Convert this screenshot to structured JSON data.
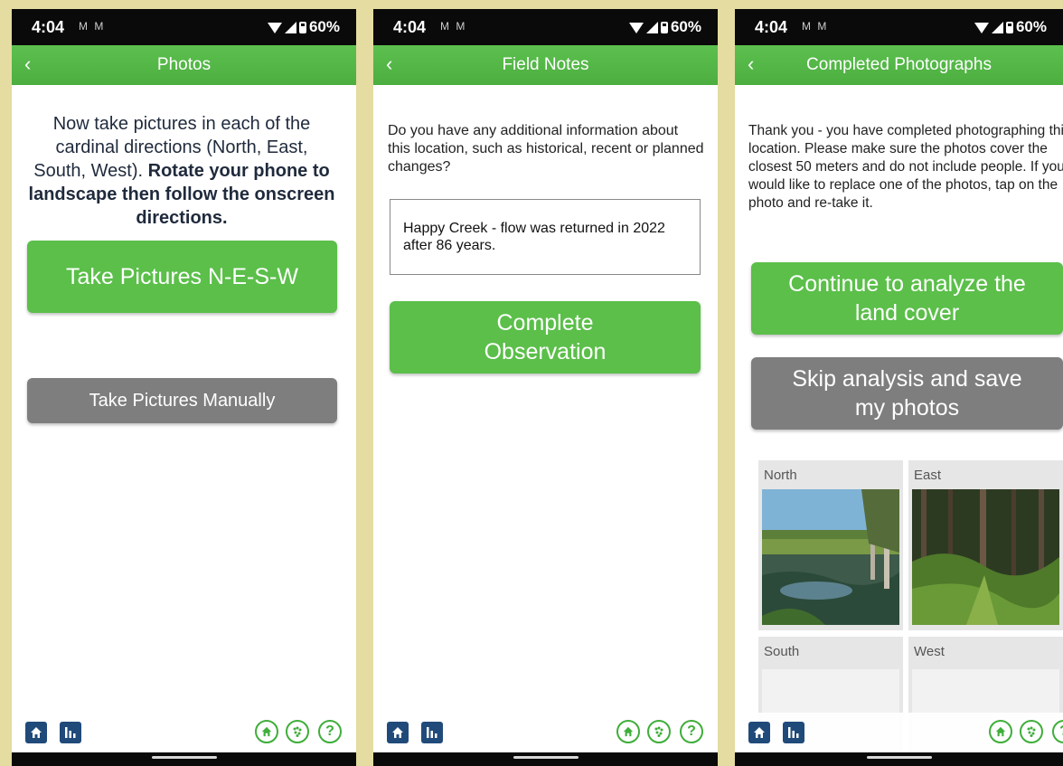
{
  "status": {
    "time": "4:04",
    "notifications": "M M",
    "battery": "60%"
  },
  "screens": {
    "photos": {
      "title": "Photos",
      "instruction_plain": "Now take pictures in each of the cardinal directions (North, East, South, West).",
      "instruction_bold": "Rotate your phone to landscape then follow the onscreen directions.",
      "take_nesw_label": "Take Pictures N-E-S-W",
      "take_manual_label": "Take Pictures Manually"
    },
    "field_notes": {
      "title": "Field Notes",
      "question": "Do you have any additional information about this location, such as historical, recent or planned changes?",
      "notes_value": "Happy Creek - flow was returned in 2022 after 86 years.",
      "complete_label": "Complete Observation"
    },
    "completed": {
      "title": "Completed Photographs",
      "message": "Thank you - you have completed photographing this location. Please make sure the photos cover the closest 50 meters and do not include people. If you would like to replace one of the photos, tap on the photo and re-take it.",
      "analyze_label": "Continue to analyze the land cover",
      "skip_label": "Skip analysis and save my photos",
      "tiles": {
        "north": "North",
        "east": "East",
        "south": "South",
        "west": "West"
      }
    }
  },
  "bottom_nav": {
    "icons": [
      "home-square-icon",
      "chart-square-icon",
      "home-circle-icon",
      "grid-circle-icon",
      "help-circle-icon"
    ],
    "help_glyph": "?"
  },
  "colors": {
    "accent_green": "#5bbf4a",
    "grey_button": "#7e7e7e",
    "nav_blue": "#204a7a",
    "background": "#e4dca0"
  }
}
